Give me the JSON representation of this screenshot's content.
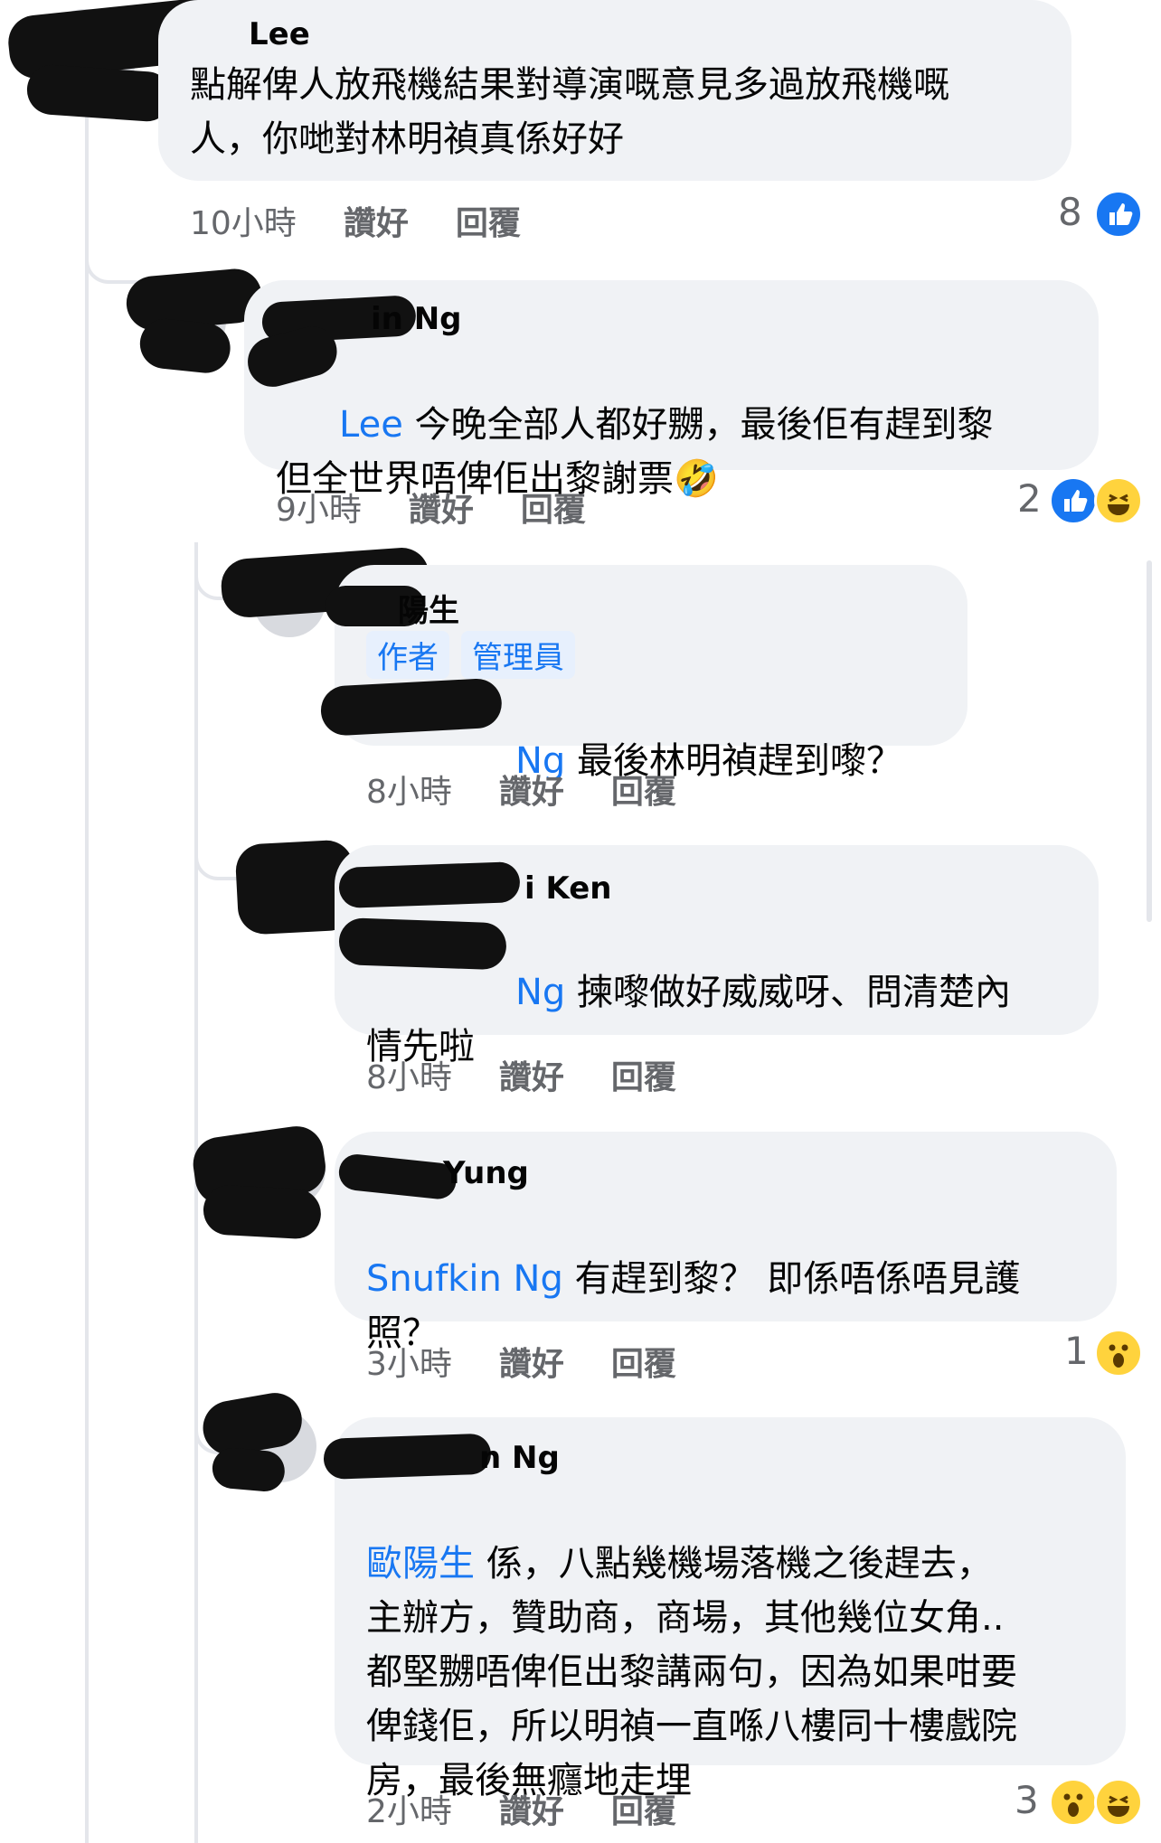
{
  "comments": [
    {
      "author": "Lee",
      "body": "點解俾人放飛機結果對導演嘅意見多過放飛機嘅\n人，你哋對林明禎真係好好",
      "time": "10小時",
      "like": "讚好",
      "reply": "回覆",
      "reaction_count": "8"
    },
    {
      "author": "in Ng",
      "mention": "Lee",
      "body": " 今晚全部人都好嬲，最後佢有趕到黎\n但全世界唔俾佢出黎謝票",
      "emoji": "🤣",
      "time": "9小時",
      "like": "讚好",
      "reply": "回覆",
      "reaction_count": "2"
    },
    {
      "author": "陽生",
      "badge_author": "作者",
      "badge_admin": "管理員",
      "mention": "Ng",
      "body": " 最後林明禎趕到嚟？",
      "time": "8小時",
      "like": "讚好",
      "reply": "回覆"
    },
    {
      "author": "i Ken",
      "mention": "Ng",
      "body": " 揀嚟做好威威呀、問清楚內\n情先啦",
      "time": "8小時",
      "like": "讚好",
      "reply": "回覆"
    },
    {
      "author": "Yung",
      "mention": "Snufkin Ng",
      "body": " 有趕到黎？  即係唔係唔見護\n照？",
      "time": "3小時",
      "like": "讚好",
      "reply": "回覆",
      "reaction_count": "1"
    },
    {
      "author": "n Ng",
      "mention": "歐陽生",
      "body": " 係，八點幾機場落機之後趕去，\n主辦方，贊助商，商場，其他幾位女角..\n都堅嬲唔俾佢出黎講兩句，因為如果咁要\n俾錢佢，所以明禎一直喺八樓同十樓戲院\n房，最後無癮地走埋",
      "time": "2小時",
      "like": "讚好",
      "reply": "回覆",
      "reaction_count": "3"
    }
  ],
  "colors": {
    "mention": "#1877f2",
    "bubble": "#f0f2f5",
    "meta": "#65676b",
    "like": "#1877f2",
    "emoji": "#ffd33d"
  },
  "icons": [
    "like-icon",
    "haha-icon",
    "wow-icon"
  ]
}
